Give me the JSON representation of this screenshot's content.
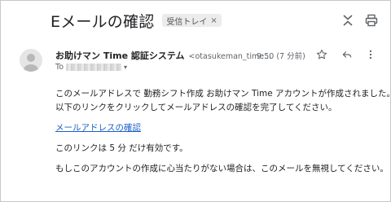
{
  "header": {
    "subject": "Eメールの確認",
    "label": "受信トレイ",
    "label_remove": "×",
    "icons": [
      "collapse-icon",
      "print-icon"
    ]
  },
  "sender": {
    "name": "お助けマン Time 認証システム",
    "email": "<otasukeman_time...",
    "time": "9:50 (7 分前)",
    "to_label": "To",
    "to_caret": "▾",
    "icons": [
      "star-icon",
      "reply-icon",
      "more-vert-icon"
    ]
  },
  "body": {
    "line1": "このメールアドレスで 勤務シフト作成 お助けマン Time アカウントが作成されました。",
    "line2": "以下のリンクをクリックしてメールアドレスの確認を完了してください。",
    "link": "メールアドレスの確認",
    "line3": "このリンクは 5 分 だけ有効です。",
    "line4": "もしこのアカウントの作成に心当たりがない場合は、このメールを無視してください。"
  }
}
